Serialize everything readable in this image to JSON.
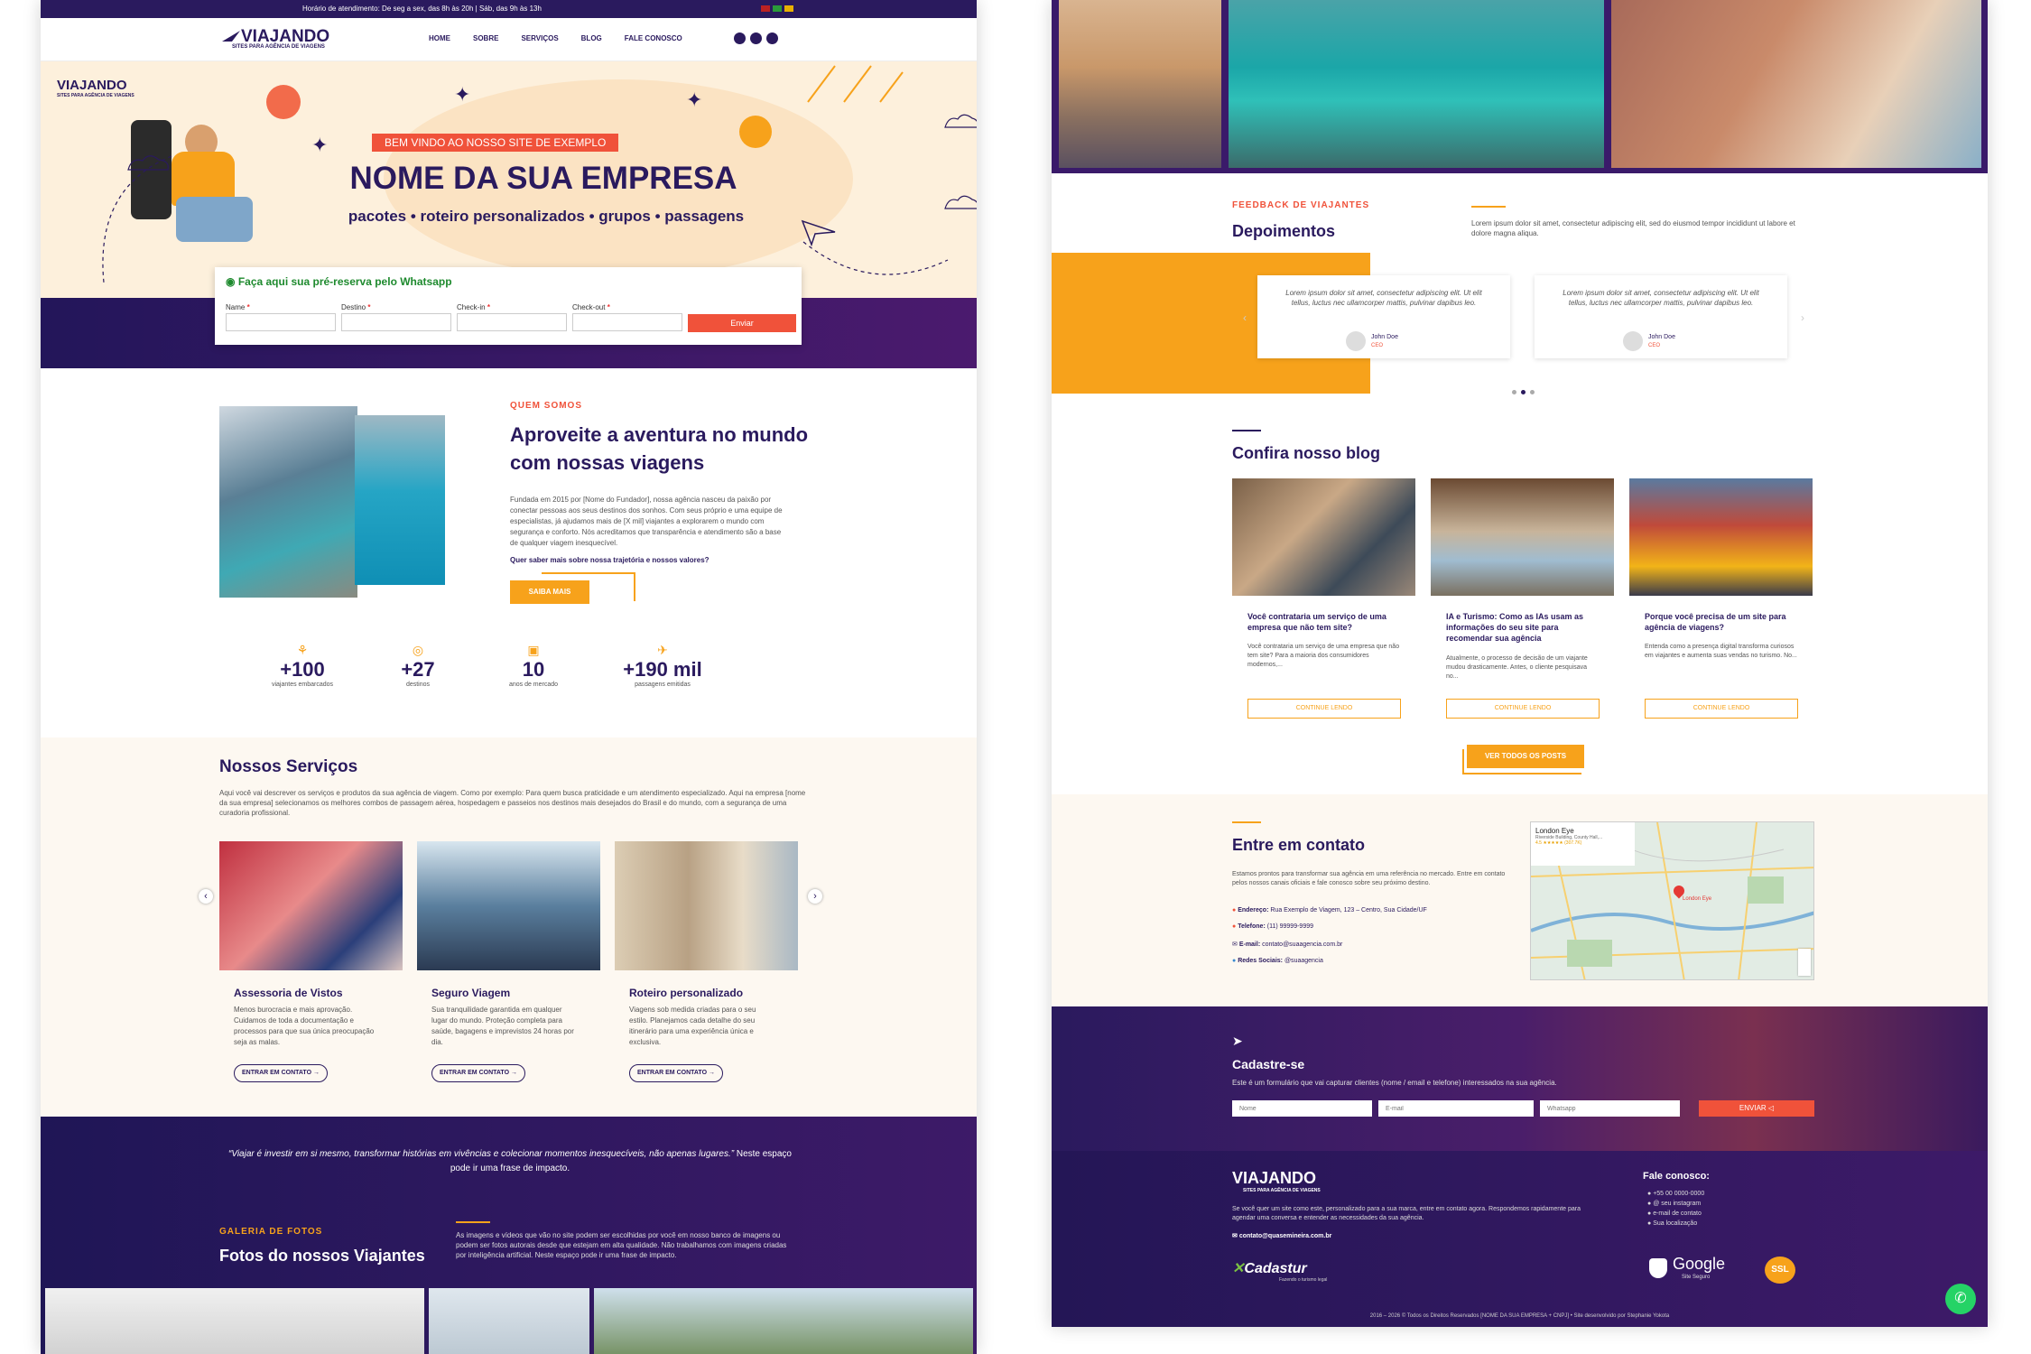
{
  "topbar": {
    "text": "Horário de atendimento: De seg a sex, das 8h às 20h | Sáb, das 9h às 13h"
  },
  "brand": {
    "name": "VIAJANDO",
    "tagline": "SITES PARA AGÊNCIA DE VIAGENS"
  },
  "nav": [
    "HOME",
    "SOBRE",
    "SERVIÇOS",
    "BLOG",
    "FALE CONOSCO"
  ],
  "hero": {
    "badge": "BEM VINDO AO NOSSO SITE DE EXEMPLO",
    "title": "NOME DA SUA EMPRESA",
    "subtitle": "pacotes • roteiro personalizados • grupos • passagens"
  },
  "booking": {
    "title": "Faça aqui sua pré-reserva pelo Whatsapp",
    "fields": [
      "Name",
      "Destino",
      "Check-in",
      "Check-out"
    ],
    "submit": "Enviar"
  },
  "about": {
    "tag": "QUEM SOMOS",
    "title": "Aproveite a aventura no mundo com nossas viagens",
    "text": "Fundada em 2015 por [Nome do Fundador], nossa agência nasceu da paixão por conectar pessoas aos seus destinos dos sonhos. Com seus próprio e uma equipe de especialistas, já ajudamos mais de [X mil] viajantes a explorarem o mundo com segurança e conforto. Nós acreditamos que transparência e atendimento são a base de qualquer viagem inesquecível.",
    "question": "Quer saber mais sobre nossa trajetória e nossos valores?",
    "button": "SAIBA MAIS"
  },
  "stats": [
    {
      "value": "+100",
      "label": "viajantes embarcados"
    },
    {
      "value": "+27",
      "label": "destinos"
    },
    {
      "value": "10",
      "label": "anos de mercado"
    },
    {
      "value": "+190 mil",
      "label": "passagens emitidas"
    }
  ],
  "services": {
    "title": "Nossos Serviços",
    "text": "Aqui você vai descrever os serviços e produtos da sua agência de viagem. Como por exemplo: Para quem busca praticidade e um atendimento especializado. Aqui na empresa [nome da sua empresa] selecionamos os melhores combos de passagem aérea, hospedagem e passeios nos destinos mais desejados do Brasil e do mundo, com a segurança de uma curadoria profissional.",
    "items": [
      {
        "title": "Assessoria de Vistos",
        "text": "Menos burocracia e mais aprovação. Cuidamos de toda a documentação e processos para que sua única preocupação seja as malas.",
        "button": "ENTRAR EM CONTATO →"
      },
      {
        "title": "Seguro Viagem",
        "text": "Sua tranquilidade garantida em qualquer lugar do mundo. Proteção completa para saúde, bagagens e imprevistos 24 horas por dia.",
        "button": "ENTRAR EM CONTATO →"
      },
      {
        "title": "Roteiro personalizado",
        "text": "Viagens sob medida criadas para o seu estilo. Planejamos cada detalhe do seu itinerário para uma experiência única e exclusiva.",
        "button": "ENTRAR EM CONTATO →"
      }
    ]
  },
  "quote": {
    "text": "“Viajar é investir em si mesmo, transformar histórias em vivências e colecionar momentos inesquecíveis, não apenas lugares.”",
    "suffix": " Neste espaço pode ir uma frase de impacto."
  },
  "gallery": {
    "tag": "GALERIA DE FOTOS",
    "title": "Fotos do nossos Viajantes",
    "text": "As imagens e vídeos que vão no site podem ser escolhidas por você em nosso banco de imagens ou podem ser fotos autorais desde que estejam em alta qualidade. Não trabalhamos com imagens criadas por inteligência artificial. Neste espaço pode ir uma frase de impacto."
  },
  "testimonials": {
    "tag": "FEEDBACK DE VIAJANTES",
    "title": "Depoimentos",
    "intro": "Lorem ipsum dolor sit amet, consectetur adipiscing elit, sed do eiusmod tempor incididunt ut labore et dolore magna aliqua.",
    "items": [
      {
        "text": "Lorem ipsum dolor sit amet, consectetur adipiscing elit. Ut elit tellus, luctus nec ullamcorper mattis, pulvinar dapibus leo.",
        "name": "John Doe",
        "role": "CEO"
      },
      {
        "text": "Lorem ipsum dolor sit amet, consectetur adipiscing elit. Ut elit tellus, luctus nec ullamcorper mattis, pulvinar dapibus leo.",
        "name": "John Doe",
        "role": "CEO"
      }
    ]
  },
  "blog": {
    "title": "Confira nosso blog",
    "posts": [
      {
        "title": "Você contrataria um serviço de uma empresa que não tem site?",
        "text": "Você contrataria um serviço de uma empresa que não tem site? Para a maioria dos consumidores modernos,...",
        "button": "CONTINUE LENDO"
      },
      {
        "title": "IA e Turismo: Como as IAs usam as informações do seu site para recomendar sua agência",
        "text": "Atualmente, o processo de decisão de um viajante mudou drasticamente. Antes, o cliente pesquisava no...",
        "button": "CONTINUE LENDO"
      },
      {
        "title": "Porque você precisa de um site para agência de viagens?",
        "text": "Entenda como a presença digital transforma curiosos em viajantes e aumenta suas vendas no turismo. No...",
        "button": "CONTINUE LENDO"
      }
    ],
    "all_button": "VER TODOS OS POSTS"
  },
  "contact": {
    "title": "Entre em contato",
    "text": "Estamos prontos para transformar sua agência em uma referência no mercado. Entre em contato pelos nossos canais oficiais e fale conosco sobre seu próximo destino.",
    "address_label": "Endereço:",
    "address": "Rua Exemplo de Viagem, 123 – Centro, Sua Cidade/UF",
    "phone_label": "Telefone:",
    "phone": "(11) 99999-9999",
    "email_label": "E-mail:",
    "email": "contato@suaagencia.com.br",
    "social_label": "Redes Sociais:",
    "social": "@suaagencia",
    "map": {
      "place": "London Eye",
      "sub": "Riverside Building, County Hall,...",
      "rating": "4.5 ★★★★★ (307.7K)",
      "label": "London Eye"
    }
  },
  "signup": {
    "title": "Cadastre-se",
    "text": "Este é um formulário que vai capturar clientes (nome / email e telefone) interessados na sua agência.",
    "placeholders": [
      "Nome",
      "E-mail",
      "Whatsapp"
    ],
    "button": "ENVIAR ◁"
  },
  "footer": {
    "text": "Se você quer um site como este, personalizado para a sua marca, entre em contato agora. Respondemos rapidamente para agendar uma conversa e entender as necessidades da sua agência.",
    "email": "contato@quasemineira.com.br",
    "contact_title": "Fale conosco:",
    "contact_items": [
      "+55 00 0000-0000",
      "@ seu instagram",
      "e-mail de contato",
      "Sua localização"
    ],
    "cadastur": "Cadastur",
    "cadastur_sub": "Fazendo o turismo legal",
    "google": "Google",
    "google_sub": "Site Seguro",
    "ssl": "SSL",
    "copyright": "2016 – 2026 © Todos os Direitos Reservados [NOME DA SUA EMPRESA + CNPJ] • Site desenvolvido por Stephanie Yokota"
  },
  "colors": {
    "navy": "#2a1a5e",
    "orange": "#f7a21b",
    "red": "#f0523a",
    "cream": "#fdf6ec"
  }
}
